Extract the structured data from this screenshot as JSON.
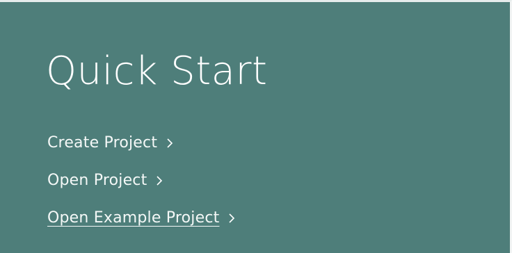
{
  "quick_start": {
    "title": "Quick Start",
    "links": [
      {
        "label": "Create Project",
        "icon": "chevron-right-icon",
        "underlined": false
      },
      {
        "label": "Open Project",
        "icon": "chevron-right-icon",
        "underlined": false
      },
      {
        "label": "Open Example Project",
        "icon": "chevron-right-icon",
        "underlined": true
      }
    ]
  },
  "colors": {
    "panel_background": "#4e7e7a",
    "text": "#ffffff"
  }
}
